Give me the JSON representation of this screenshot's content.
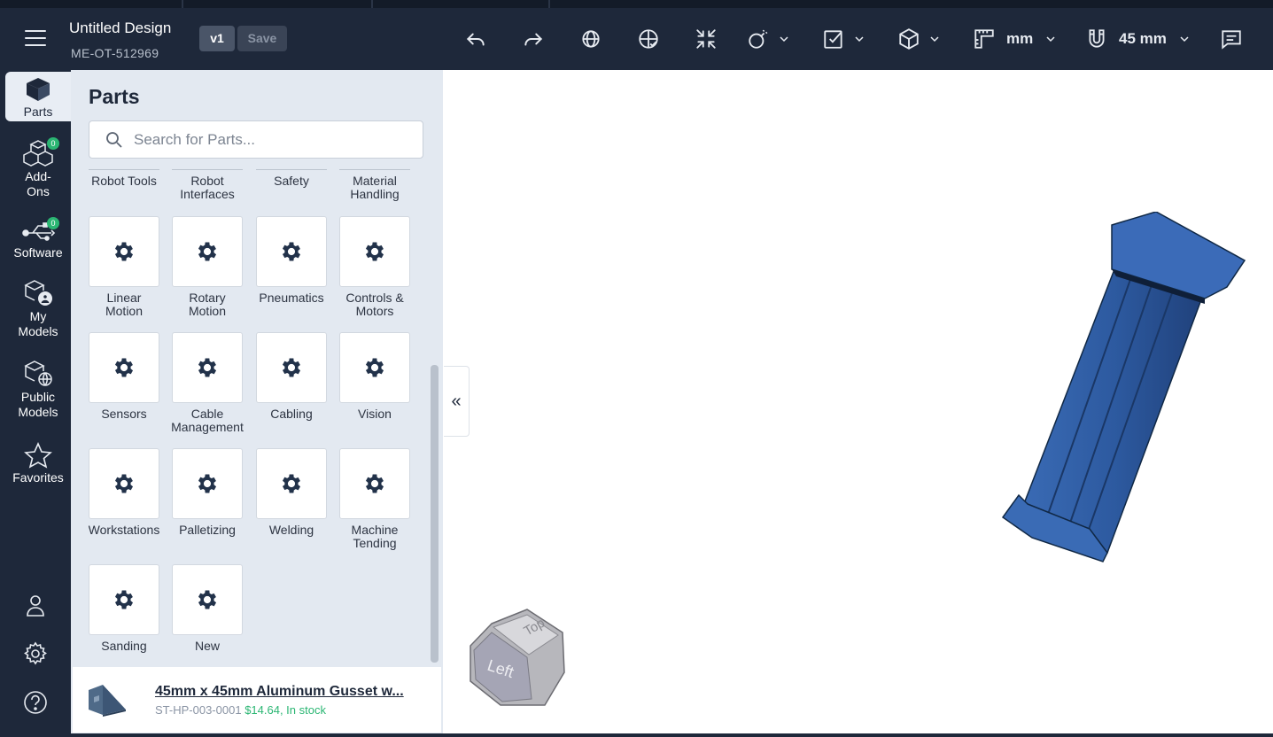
{
  "header": {
    "title": "Untitled Design",
    "subtitle": "ME-OT-512969",
    "version": "v1",
    "save_label": "Save",
    "units_label": "mm",
    "snap_label": "45 mm"
  },
  "nav": {
    "items": [
      {
        "label": "Parts"
      },
      {
        "label": "Add-\nOns",
        "badge": "0"
      },
      {
        "label": "Software",
        "badge": "0"
      },
      {
        "label": "My\nModels"
      },
      {
        "label": "Public\nModels"
      },
      {
        "label": "Favorites"
      }
    ]
  },
  "panel": {
    "title": "Parts",
    "search_placeholder": "Search for Parts...",
    "top_categories": [
      "Robot Tools",
      "Robot\nInterfaces",
      "Safety",
      "Material\nHandling"
    ],
    "categories": [
      "Linear\nMotion",
      "Rotary\nMotion",
      "Pneumatics",
      "Controls &\nMotors",
      "Sensors",
      "Cable\nManagement",
      "Cabling",
      "Vision",
      "Workstations",
      "Palletizing",
      "Welding",
      "Machine\nTending",
      "Sanding",
      "New"
    ]
  },
  "product": {
    "name": "45mm x 45mm Aluminum Gusset w...",
    "sku": "ST-HP-003-0001",
    "price": "$14.64, In stock"
  },
  "viewcube": {
    "top_label": "Top",
    "left_label": "Left"
  },
  "colors": {
    "header_bg": "#1e283a",
    "panel_bg": "#e3e9f1",
    "accent_green": "#2bb673",
    "model_blue": "#2f5fa3"
  }
}
